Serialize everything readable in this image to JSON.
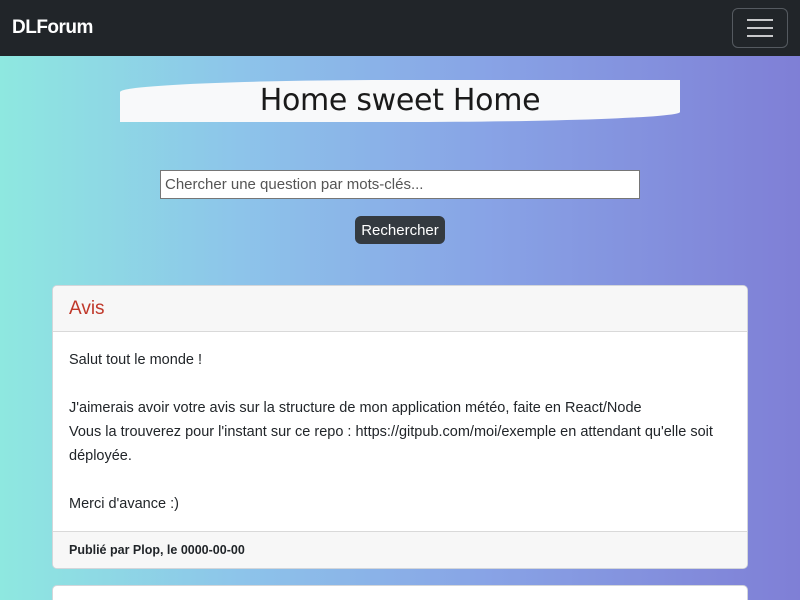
{
  "navbar": {
    "brand": "DLForum",
    "toggler_icon": "hamburger-menu-icon"
  },
  "hero": {
    "title": "Home sweet Home"
  },
  "search": {
    "placeholder": "Chercher une question par mots-clés...",
    "value": "",
    "button_label": "Rechercher"
  },
  "posts": [
    {
      "title": "Avis",
      "body": [
        "Salut tout le monde !",
        "",
        "J'aimerais avoir votre avis sur la structure de mon application météo, faite en React/Node",
        "Vous la trouverez pour l'instant sur ce repo : https://gitpub.com/moi/exemple en attendant qu'elle soit déployée.",
        "",
        "Merci d'avance :)"
      ],
      "footer": "Publié par Plop, le 0000-00-00"
    }
  ],
  "colors": {
    "navbar_bg": "#212529",
    "post_title": "#c0392b",
    "button_bg": "#343a40",
    "gradient_start": "#8ee8e0",
    "gradient_end": "#7f7fd6"
  }
}
